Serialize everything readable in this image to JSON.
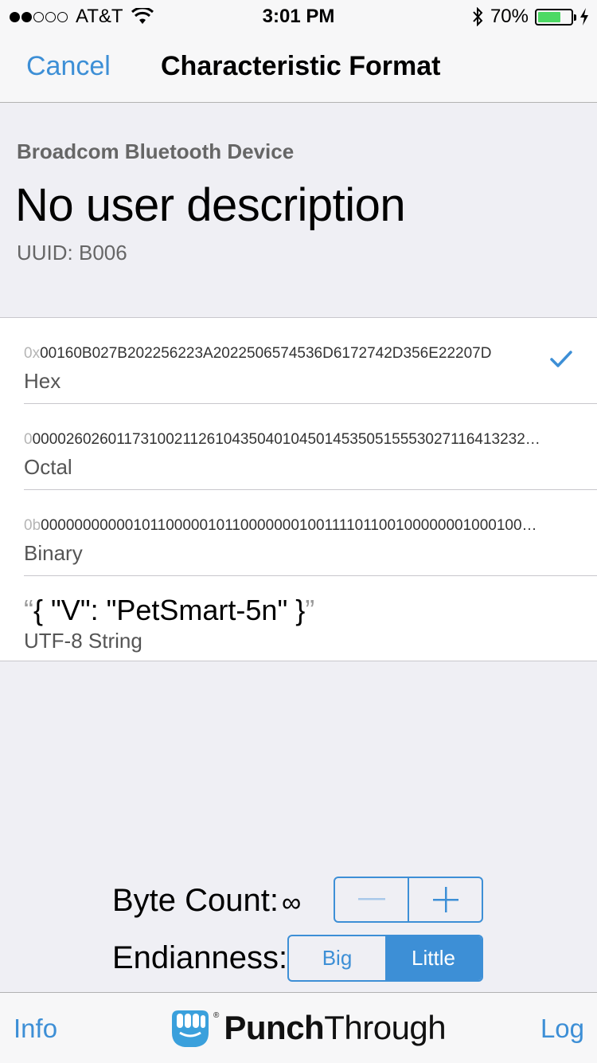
{
  "status_bar": {
    "carrier": "AT&T",
    "time": "3:01 PM",
    "battery_percent": "70%",
    "battery_level": 0.7,
    "signal_bars_filled": 2,
    "signal_bars_total": 5
  },
  "nav": {
    "cancel_label": "Cancel",
    "title": "Characteristic Format"
  },
  "header": {
    "device_name": "Broadcom Bluetooth Device",
    "user_description": "No user description",
    "uuid": "UUID: B006"
  },
  "formats": [
    {
      "prefix": "0x",
      "value": "00160B027B202256223A2022506574536D6172742D356E22207D",
      "label": "Hex",
      "selected": true
    },
    {
      "prefix": "0",
      "value": "00002602601173100211261043504010450145350515553027116413232…",
      "label": "Octal",
      "selected": false
    },
    {
      "prefix": "0b",
      "value": "0000000000010110000010110000000100111101100100000001000100…",
      "label": "Binary",
      "selected": false
    },
    {
      "open_quote": "“",
      "value": "{ \"V\": \"PetSmart-5n\" }",
      "close_quote": "”",
      "label": "UTF-8 String",
      "selected": false
    }
  ],
  "controls": {
    "byte_count_label": "Byte Count:",
    "byte_count_value": "∞",
    "endianness_label": "Endianness:",
    "endianness_options": [
      "Big",
      "Little"
    ],
    "endianness_selected": "Little"
  },
  "tab_bar": {
    "info_label": "Info",
    "log_label": "Log",
    "logo_text_bold": "Punch",
    "logo_text_regular": "Through"
  },
  "colors": {
    "accent": "#3d8fd6",
    "battery": "#4cd964",
    "background": "#efeff4"
  }
}
